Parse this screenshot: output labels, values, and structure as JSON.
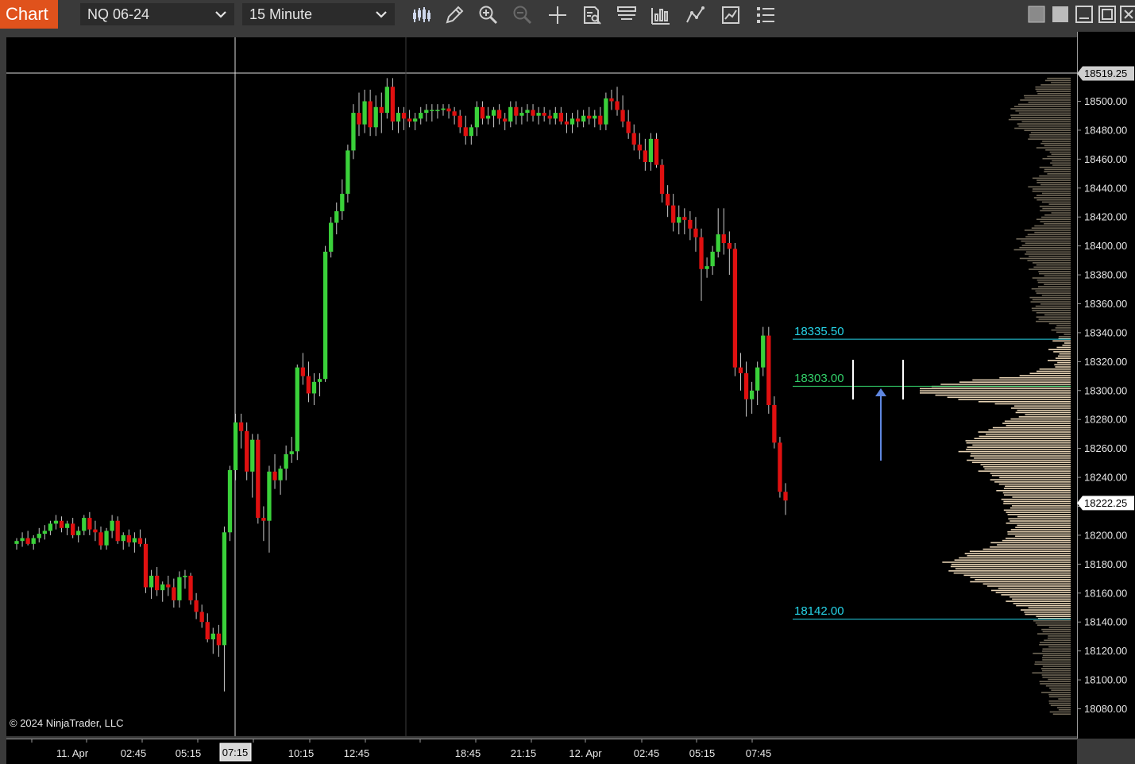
{
  "toolbar": {
    "app_label": "Chart",
    "instrument": "NQ 06-24",
    "interval": "15 Minute",
    "icons": [
      "bars-type-icon",
      "draw-pencil-icon",
      "zoom-in-icon",
      "zoom-out-icon",
      "crosshair-icon",
      "data-box-icon",
      "chart-trader-icon",
      "indicators-icon",
      "strategies-icon",
      "templates-icon",
      "properties-menu-icon"
    ],
    "window_icons": [
      "tile-left-icon",
      "tile-right-icon",
      "minimize-icon",
      "maximize-icon",
      "close-icon"
    ]
  },
  "colors": {
    "up": "#3ad13a",
    "down": "#e01010",
    "wick": "#c8c8c8",
    "profile_va": "#e7d3b4",
    "profile_outside": "#6e6656",
    "level_cyan": "#26d4e8",
    "poc_green": "#33d06a",
    "arrow": "#5f87e0"
  },
  "price_axis": {
    "ticks": [
      "18500.00",
      "18480.00",
      "18460.00",
      "18440.00",
      "18420.00",
      "18400.00",
      "18380.00",
      "18360.00",
      "18340.00",
      "18320.00",
      "18300.00",
      "18280.00",
      "18260.00",
      "18240.00",
      "18220.00",
      "18200.00",
      "18180.00",
      "18160.00",
      "18140.00",
      "18120.00",
      "18100.00",
      "18080.00"
    ],
    "crosshair_price": "18519.25",
    "last_price": "18222.25"
  },
  "time_axis": {
    "ticks": [
      "11. Apr",
      "02:45",
      "05:15",
      "07:15",
      "10:15",
      "12:45",
      "18:45",
      "21:15",
      "12. Apr",
      "02:45",
      "05:15",
      "07:45"
    ],
    "crosshair_time": "07:15"
  },
  "levels": {
    "value_area_high": "18335.50",
    "poc": "18303.00",
    "value_area_low": "18142.00"
  },
  "copyright": "© 2024 NinjaTrader, LLC",
  "chart_data": {
    "type": "candlestick",
    "instrument": "NQ 06-24",
    "interval": "15 Minute",
    "ylim": [
      18070,
      18530
    ],
    "series": [
      {
        "values": [
          [
            18194,
            18198,
            18190,
            18196
          ],
          [
            18196,
            18202,
            18192,
            18198
          ],
          [
            18198,
            18203,
            18193,
            18194
          ],
          [
            18194,
            18200,
            18190,
            18198
          ],
          [
            18198,
            18205,
            18195,
            18201
          ],
          [
            18201,
            18207,
            18197,
            18203
          ],
          [
            18203,
            18210,
            18200,
            18208
          ],
          [
            18208,
            18214,
            18204,
            18210
          ],
          [
            18210,
            18213,
            18202,
            18205
          ],
          [
            18205,
            18210,
            18200,
            18208
          ],
          [
            18208,
            18212,
            18198,
            18200
          ],
          [
            18200,
            18206,
            18195,
            18203
          ],
          [
            18203,
            18214,
            18200,
            18212
          ],
          [
            18212,
            18216,
            18200,
            18204
          ],
          [
            18204,
            18210,
            18196,
            18202
          ],
          [
            18202,
            18206,
            18190,
            18193
          ],
          [
            18193,
            18205,
            18190,
            18203
          ],
          [
            18203,
            18214,
            18198,
            18210
          ],
          [
            18210,
            18213,
            18194,
            18196
          ],
          [
            18196,
            18202,
            18190,
            18200
          ],
          [
            18200,
            18204,
            18192,
            18195
          ],
          [
            18195,
            18202,
            18188,
            18198
          ],
          [
            18198,
            18204,
            18192,
            18194
          ],
          [
            18194,
            18198,
            18160,
            18164
          ],
          [
            18164,
            18176,
            18156,
            18172
          ],
          [
            18172,
            18178,
            18158,
            18162
          ],
          [
            18162,
            18168,
            18154,
            18166
          ],
          [
            18166,
            18172,
            18158,
            18164
          ],
          [
            18164,
            18170,
            18150,
            18155
          ],
          [
            18155,
            18175,
            18150,
            18171
          ],
          [
            18171,
            18176,
            18163,
            18172
          ],
          [
            18172,
            18174,
            18152,
            18155
          ],
          [
            18155,
            18160,
            18142,
            18147
          ],
          [
            18147,
            18152,
            18136,
            18140
          ],
          [
            18140,
            18146,
            18126,
            18128
          ],
          [
            18128,
            18136,
            18118,
            18132
          ],
          [
            18132,
            18138,
            18116,
            18124
          ],
          [
            18124,
            18206,
            18092,
            18202
          ],
          [
            18202,
            18248,
            18196,
            18245
          ],
          [
            18245,
            18284,
            18238,
            18278
          ],
          [
            18278,
            18284,
            18260,
            18272
          ],
          [
            18272,
            18278,
            18238,
            18244
          ],
          [
            18244,
            18270,
            18226,
            18266
          ],
          [
            18266,
            18270,
            18208,
            18212
          ],
          [
            18212,
            18220,
            18196,
            18210
          ],
          [
            18210,
            18248,
            18188,
            18244
          ],
          [
            18244,
            18256,
            18232,
            18238
          ],
          [
            18238,
            18248,
            18228,
            18246
          ],
          [
            18246,
            18262,
            18238,
            18256
          ],
          [
            18256,
            18268,
            18250,
            18258
          ],
          [
            18258,
            18318,
            18252,
            18316
          ],
          [
            18316,
            18326,
            18304,
            18310
          ],
          [
            18310,
            18320,
            18292,
            18298
          ],
          [
            18298,
            18312,
            18290,
            18306
          ],
          [
            18306,
            18312,
            18296,
            18308
          ],
          [
            18308,
            18400,
            18306,
            18396
          ],
          [
            18396,
            18420,
            18392,
            18416
          ],
          [
            18416,
            18430,
            18408,
            18424
          ],
          [
            18424,
            18446,
            18418,
            18436
          ],
          [
            18436,
            18470,
            18430,
            18466
          ],
          [
            18466,
            18498,
            18460,
            18492
          ],
          [
            18492,
            18506,
            18476,
            18484
          ],
          [
            18484,
            18508,
            18478,
            18500
          ],
          [
            18500,
            18508,
            18476,
            18482
          ],
          [
            18482,
            18504,
            18476,
            18496
          ],
          [
            18496,
            18506,
            18478,
            18492
          ],
          [
            18492,
            18516,
            18488,
            18510
          ],
          [
            18510,
            18516,
            18480,
            18486
          ],
          [
            18486,
            18496,
            18478,
            18492
          ],
          [
            18492,
            18496,
            18480,
            18488
          ],
          [
            18488,
            18494,
            18482,
            18486
          ],
          [
            18486,
            18492,
            18480,
            18488
          ],
          [
            18488,
            18496,
            18484,
            18492
          ],
          [
            18492,
            18498,
            18486,
            18494
          ],
          [
            18494,
            18498,
            18486,
            18494
          ],
          [
            18494,
            18498,
            18488,
            18494
          ],
          [
            18494,
            18498,
            18490,
            18495
          ],
          [
            18495,
            18498,
            18488,
            18493
          ],
          [
            18493,
            18496,
            18484,
            18490
          ],
          [
            18490,
            18494,
            18478,
            18482
          ],
          [
            18482,
            18490,
            18470,
            18476
          ],
          [
            18476,
            18484,
            18470,
            18482
          ],
          [
            18482,
            18500,
            18476,
            18496
          ],
          [
            18496,
            18500,
            18484,
            18488
          ],
          [
            18488,
            18496,
            18484,
            18490
          ],
          [
            18490,
            18496,
            18482,
            18494
          ],
          [
            18494,
            18498,
            18484,
            18488
          ],
          [
            18488,
            18492,
            18480,
            18486
          ],
          [
            18486,
            18500,
            18482,
            18496
          ],
          [
            18496,
            18500,
            18484,
            18490
          ],
          [
            18490,
            18496,
            18484,
            18492
          ],
          [
            18492,
            18498,
            18486,
            18494
          ],
          [
            18494,
            18498,
            18486,
            18490
          ],
          [
            18490,
            18496,
            18484,
            18492
          ],
          [
            18492,
            18496,
            18486,
            18490
          ],
          [
            18490,
            18494,
            18484,
            18488
          ],
          [
            18488,
            18496,
            18484,
            18492
          ],
          [
            18492,
            18496,
            18484,
            18486
          ],
          [
            18486,
            18492,
            18478,
            18484
          ],
          [
            18484,
            18492,
            18478,
            18488
          ],
          [
            18488,
            18494,
            18482,
            18486
          ],
          [
            18486,
            18494,
            18482,
            18490
          ],
          [
            18490,
            18496,
            18484,
            18488
          ],
          [
            18488,
            18494,
            18482,
            18490
          ],
          [
            18490,
            18496,
            18480,
            18484
          ],
          [
            18484,
            18506,
            18480,
            18502
          ],
          [
            18502,
            18508,
            18494,
            18500
          ],
          [
            18500,
            18510,
            18490,
            18494
          ],
          [
            18494,
            18504,
            18482,
            18486
          ],
          [
            18486,
            18494,
            18474,
            18478
          ],
          [
            18478,
            18484,
            18466,
            18470
          ],
          [
            18470,
            18478,
            18460,
            18466
          ],
          [
            18466,
            18474,
            18452,
            18458
          ],
          [
            18458,
            18478,
            18452,
            18474
          ],
          [
            18474,
            18478,
            18454,
            18456
          ],
          [
            18456,
            18460,
            18430,
            18436
          ],
          [
            18436,
            18442,
            18420,
            18428
          ],
          [
            18428,
            18436,
            18410,
            18416
          ],
          [
            18416,
            18428,
            18408,
            18420
          ],
          [
            18420,
            18426,
            18408,
            18418
          ],
          [
            18418,
            18424,
            18404,
            18412
          ],
          [
            18412,
            18420,
            18396,
            18406
          ],
          [
            18406,
            18412,
            18362,
            18384
          ],
          [
            18384,
            18392,
            18378,
            18386
          ],
          [
            18386,
            18400,
            18380,
            18396
          ],
          [
            18396,
            18426,
            18392,
            18408
          ],
          [
            18408,
            18426,
            18394,
            18402
          ],
          [
            18402,
            18410,
            18380,
            18398
          ],
          [
            18398,
            18402,
            18310,
            18316
          ],
          [
            18316,
            18326,
            18300,
            18312
          ],
          [
            18312,
            18320,
            18282,
            18294
          ],
          [
            18294,
            18306,
            18284,
            18300
          ],
          [
            18300,
            18320,
            18290,
            18316
          ],
          [
            18316,
            18344,
            18310,
            18338
          ],
          [
            18338,
            18344,
            18284,
            18290
          ],
          [
            18290,
            18296,
            18260,
            18264
          ],
          [
            18264,
            18268,
            18226,
            18230
          ],
          [
            18230,
            18236,
            18214,
            18224
          ]
        ]
      }
    ],
    "volume_profile": {
      "poc": 18303.0,
      "value_area_high": 18335.5,
      "value_area_low": 18142.0
    }
  }
}
